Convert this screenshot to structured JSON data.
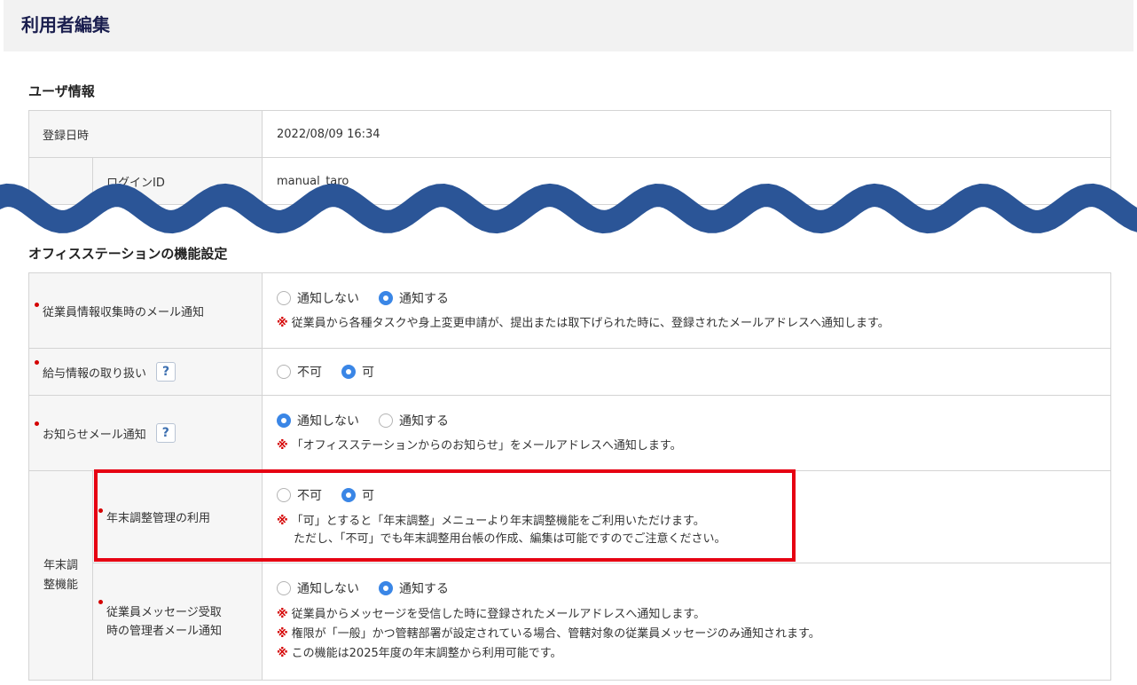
{
  "page": {
    "title": "利用者編集"
  },
  "user_info": {
    "section_title": "ユーザ情報",
    "registered_label": "登録日時",
    "registered_value": "2022/08/09 16:34",
    "login_id_label": "ログインID",
    "login_id_value": "manual_taro"
  },
  "function_settings": {
    "section_title": "オフィスステーションの機能設定",
    "rows": [
      {
        "label": "従業員情報収集時のメール通知",
        "options": [
          "通知しない",
          "通知する"
        ],
        "selected": "通知する",
        "notes": [
          "従業員から各種タスクや身上変更申請が、提出または取下げられた時に、登録されたメールアドレスへ通知します。"
        ]
      },
      {
        "label": "給与情報の取り扱い",
        "help": "?",
        "options": [
          "不可",
          "可"
        ],
        "selected": "可"
      },
      {
        "label": "お知らせメール通知",
        "help": "?",
        "options": [
          "通知しない",
          "通知する"
        ],
        "selected": "通知しない",
        "notes": [
          "「オフィスステーションからのお知らせ」をメールアドレスへ通知します。"
        ]
      }
    ],
    "year_end_group": {
      "label_line1": "年末調",
      "label_line2": "整機能",
      "rows": [
        {
          "label": "年末調整管理の利用",
          "options": [
            "不可",
            "可"
          ],
          "selected": "可",
          "note_line1": "「可」とすると「年末調整」メニューより年末調整機能をご利用いただけます。",
          "note_line2": "ただし、「不可」でも年末調整用台帳の作成、編集は可能ですのでご注意ください。"
        },
        {
          "label_line1": "従業員メッセージ受取",
          "label_line2": "時の管理者メール通知",
          "options": [
            "通知しない",
            "通知する"
          ],
          "selected": "通知する",
          "notes": [
            "従業員からメッセージを受信した時に登録されたメールアドレスへ通知します。",
            "権限が「一般」かつ管轄部署が設定されている場合、管轄対象の従業員メッセージのみ通知されます。",
            "この機能は2025年度の年末調整から利用可能です。"
          ]
        }
      ]
    }
  },
  "note_mark": "※",
  "colors": {
    "accent": "#3a86e6",
    "required": "#d40000",
    "highlight": "#e60012",
    "wave": "#2b5597",
    "title": "#1a1e4e"
  }
}
